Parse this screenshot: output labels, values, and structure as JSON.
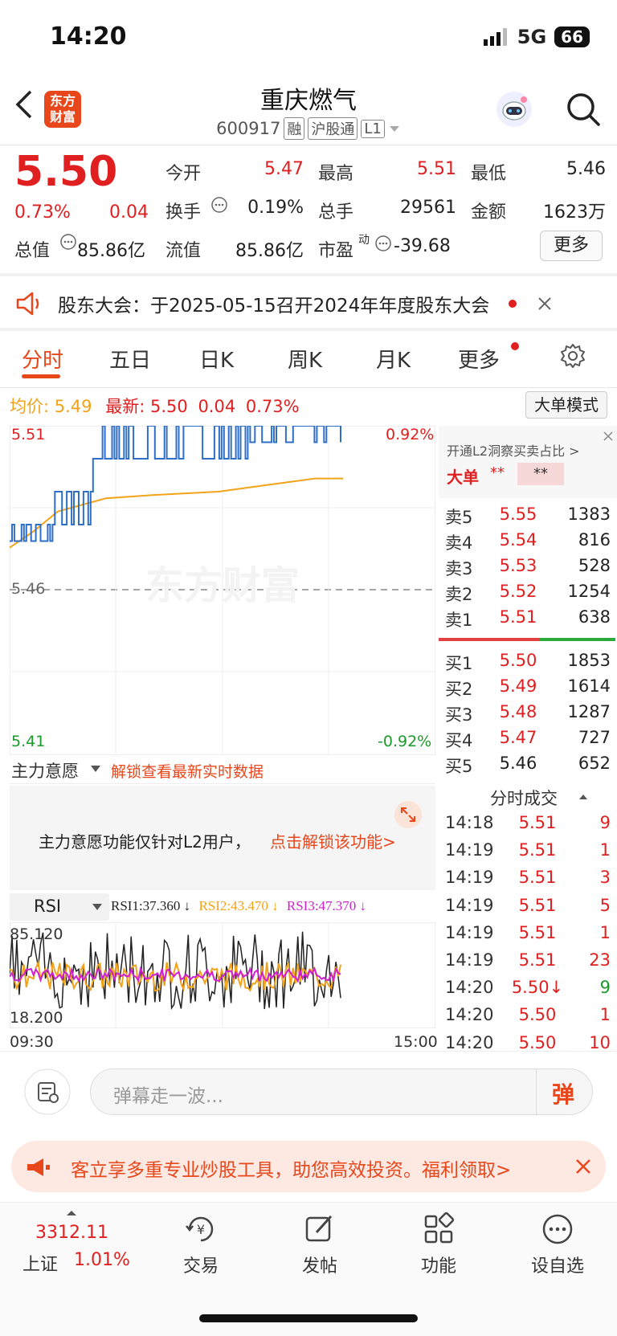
{
  "status": {
    "time": "14:20",
    "network": "5G",
    "battery": "66"
  },
  "header": {
    "logo_line1": "东方",
    "logo_line2": "财富",
    "title": "重庆燃气",
    "code": "600917",
    "tags": [
      "融",
      "沪股通",
      "L1"
    ]
  },
  "quote": {
    "price": "5.50",
    "change_pct": "0.73%",
    "change": "0.04",
    "fields": {
      "open_label": "今开",
      "open": "5.47",
      "high_label": "最高",
      "high": "5.51",
      "low_label": "最低",
      "low": "5.46",
      "turnover_label": "换手",
      "turnover": "0.19%",
      "volume_label": "总手",
      "volume": "29561",
      "amount_label": "金额",
      "amount": "1623万",
      "total_mv_label": "总值",
      "total_mv": "85.86亿",
      "float_mv_label": "流值",
      "float_mv": "85.86亿",
      "pe_label": "市盈",
      "pe_sup": "动",
      "pe": "-39.68"
    },
    "more_label": "更多"
  },
  "notice": {
    "text": "股东大会：于2025-05-15召开2024年年度股东大会"
  },
  "tabs": [
    "分时",
    "五日",
    "日K",
    "周K",
    "月K",
    "更多"
  ],
  "chart": {
    "avg_label": "均价:",
    "avg": "5.49",
    "latest_label": "最新:",
    "latest": "5.50",
    "latest_change": "0.04",
    "latest_pct": "0.73%",
    "big_mode_label": "大单模式",
    "y_top": "5.51",
    "y_mid": "5.46",
    "y_bottom": "5.41",
    "pct_top": "0.92%",
    "pct_bottom": "-0.92%",
    "watermark": "东方财富",
    "indicator_label": "主力意愿",
    "unlock_link": "解锁查看最新实时数据",
    "l2_notice": "主力意愿功能仅针对L2用户，",
    "l2_unlock": "点击解锁该功能>",
    "rsi_label": "RSI",
    "rsi1": "RSI1:37.360 ↓",
    "rsi2": "RSI2:43.470 ↓",
    "rsi3": "RSI3:47.370 ↓",
    "rsi_top": "85.120",
    "rsi_bottom": "18.200",
    "time_start": "09:30",
    "time_end": "15:00",
    "colors": {
      "price": "#2f6fc7",
      "avg": "#f2a31a",
      "rsi1": "#222222",
      "rsi2": "#f2a31a",
      "rsi3": "#d020d0"
    }
  },
  "orderbook": {
    "l2_banner": "开通L2洞察买卖占比 >",
    "big_label": "大单",
    "big_val1": "**",
    "big_val2": "**",
    "asks": [
      {
        "label": "卖5",
        "price": "5.55",
        "vol": "1383"
      },
      {
        "label": "卖4",
        "price": "5.54",
        "vol": "816"
      },
      {
        "label": "卖3",
        "price": "5.53",
        "vol": "528"
      },
      {
        "label": "卖2",
        "price": "5.52",
        "vol": "1254"
      },
      {
        "label": "卖1",
        "price": "5.51",
        "vol": "638"
      }
    ],
    "bids": [
      {
        "label": "买1",
        "price": "5.50",
        "vol": "1853"
      },
      {
        "label": "买2",
        "price": "5.49",
        "vol": "1614"
      },
      {
        "label": "买3",
        "price": "5.48",
        "vol": "1287"
      },
      {
        "label": "买4",
        "price": "5.47",
        "vol": "727"
      },
      {
        "label": "买5",
        "price": "5.46",
        "vol": "652"
      }
    ],
    "trades_title": "分时成交",
    "trades": [
      {
        "time": "14:18",
        "price": "5.51",
        "vol": "9"
      },
      {
        "time": "14:19",
        "price": "5.51",
        "vol": "1"
      },
      {
        "time": "14:19",
        "price": "5.51",
        "vol": "3"
      },
      {
        "time": "14:19",
        "price": "5.51",
        "vol": "5"
      },
      {
        "time": "14:19",
        "price": "5.51",
        "vol": "1"
      },
      {
        "time": "14:19",
        "price": "5.51",
        "vol": "23"
      },
      {
        "time": "14:20",
        "price": "5.50↓",
        "vol": "9"
      },
      {
        "time": "14:20",
        "price": "5.50",
        "vol": "1"
      },
      {
        "time": "14:20",
        "price": "5.50",
        "vol": "10"
      }
    ]
  },
  "danmu": {
    "placeholder": "弹幕走一波...",
    "send_label": "弹"
  },
  "promo": {
    "text": "客立享多重专业炒股工具，助您高效投资。福利领取>"
  },
  "nav": {
    "index_value": "3312.11",
    "index_name": "上证",
    "index_pct": "1.01%",
    "items": [
      "交易",
      "发帖",
      "功能",
      "设自选"
    ]
  }
}
